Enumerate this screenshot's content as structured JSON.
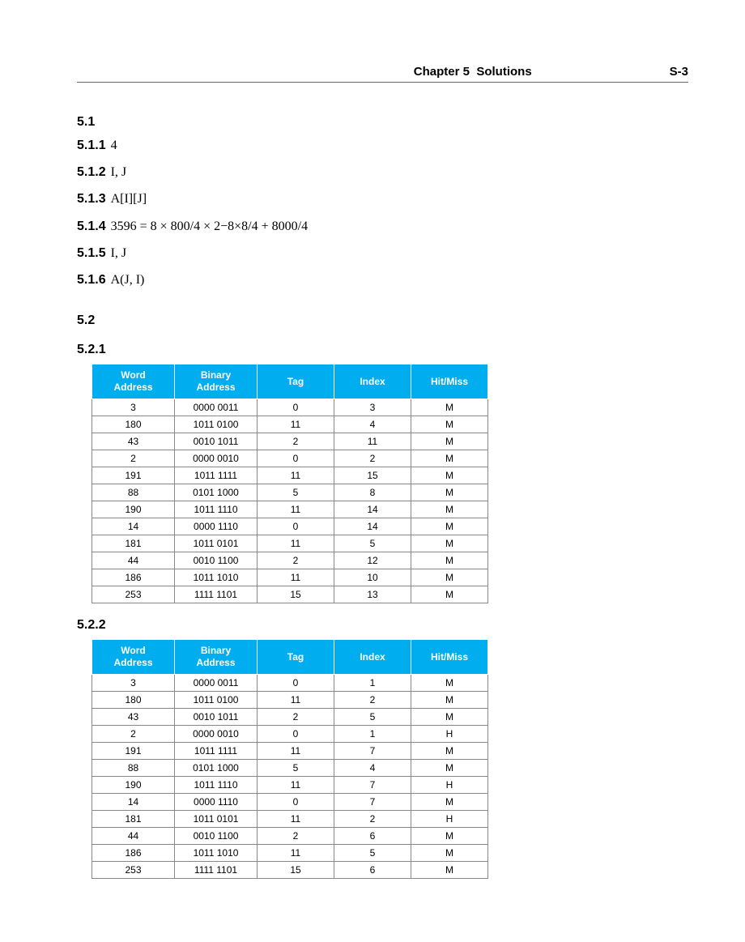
{
  "header": {
    "chapter": "Chapter 5",
    "title": "Solutions",
    "page": "S-3"
  },
  "sections": {
    "s5_1": "5.1",
    "s5_2": "5.2",
    "s5_2_1": "5.2.1",
    "s5_2_2": "5.2.2"
  },
  "items": {
    "i511": {
      "label": "5.1.1",
      "text": "4"
    },
    "i512": {
      "label": "5.1.2",
      "text": "I, J"
    },
    "i513": {
      "label": "5.1.3",
      "text": "A[I][J]"
    },
    "i514": {
      "label": "5.1.4",
      "text": "3596 = 8 × 800/4 × 2−8×8/4 + 8000/4"
    },
    "i515": {
      "label": "5.1.5",
      "text": "I, J"
    },
    "i516": {
      "label": "5.1.6",
      "text": "A(J, I)"
    }
  },
  "table_headers": {
    "word": "Word\nAddress",
    "binary": "Binary\nAddress",
    "tag": "Tag",
    "index": "Index",
    "hitmiss": "Hit/Miss"
  },
  "table_521": [
    {
      "w": "3",
      "b": "0000 0011",
      "t": "0",
      "i": "3",
      "hm": "M"
    },
    {
      "w": "180",
      "b": "1011 0100",
      "t": "11",
      "i": "4",
      "hm": "M"
    },
    {
      "w": "43",
      "b": "0010 1011",
      "t": "2",
      "i": "11",
      "hm": "M"
    },
    {
      "w": "2",
      "b": "0000 0010",
      "t": "0",
      "i": "2",
      "hm": "M"
    },
    {
      "w": "191",
      "b": "1011 1111",
      "t": "11",
      "i": "15",
      "hm": "M"
    },
    {
      "w": "88",
      "b": "0101 1000",
      "t": "5",
      "i": "8",
      "hm": "M"
    },
    {
      "w": "190",
      "b": "1011 1110",
      "t": "11",
      "i": "14",
      "hm": "M"
    },
    {
      "w": "14",
      "b": "0000 1110",
      "t": "0",
      "i": "14",
      "hm": "M"
    },
    {
      "w": "181",
      "b": "1011 0101",
      "t": "11",
      "i": "5",
      "hm": "M"
    },
    {
      "w": "44",
      "b": "0010 1100",
      "t": "2",
      "i": "12",
      "hm": "M"
    },
    {
      "w": "186",
      "b": "1011 1010",
      "t": "11",
      "i": "10",
      "hm": "M"
    },
    {
      "w": "253",
      "b": "1111 1101",
      "t": "15",
      "i": "13",
      "hm": "M"
    }
  ],
  "table_522": [
    {
      "w": "3",
      "b": "0000 0011",
      "t": "0",
      "i": "1",
      "hm": "M"
    },
    {
      "w": "180",
      "b": "1011 0100",
      "t": "11",
      "i": "2",
      "hm": "M"
    },
    {
      "w": "43",
      "b": "0010 1011",
      "t": "2",
      "i": "5",
      "hm": "M"
    },
    {
      "w": "2",
      "b": "0000 0010",
      "t": "0",
      "i": "1",
      "hm": "H"
    },
    {
      "w": "191",
      "b": "1011 1111",
      "t": "11",
      "i": "7",
      "hm": "M"
    },
    {
      "w": "88",
      "b": "0101 1000",
      "t": "5",
      "i": "4",
      "hm": "M"
    },
    {
      "w": "190",
      "b": "1011 1110",
      "t": "11",
      "i": "7",
      "hm": "H"
    },
    {
      "w": "14",
      "b": "0000 1110",
      "t": "0",
      "i": "7",
      "hm": "M"
    },
    {
      "w": "181",
      "b": "1011 0101",
      "t": "11",
      "i": "2",
      "hm": "H"
    },
    {
      "w": "44",
      "b": "0010 1100",
      "t": "2",
      "i": "6",
      "hm": "M"
    },
    {
      "w": "186",
      "b": "1011 1010",
      "t": "11",
      "i": "5",
      "hm": "M"
    },
    {
      "w": "253",
      "b": "1111 1101",
      "t": "15",
      "i": "6",
      "hm": "M"
    }
  ]
}
